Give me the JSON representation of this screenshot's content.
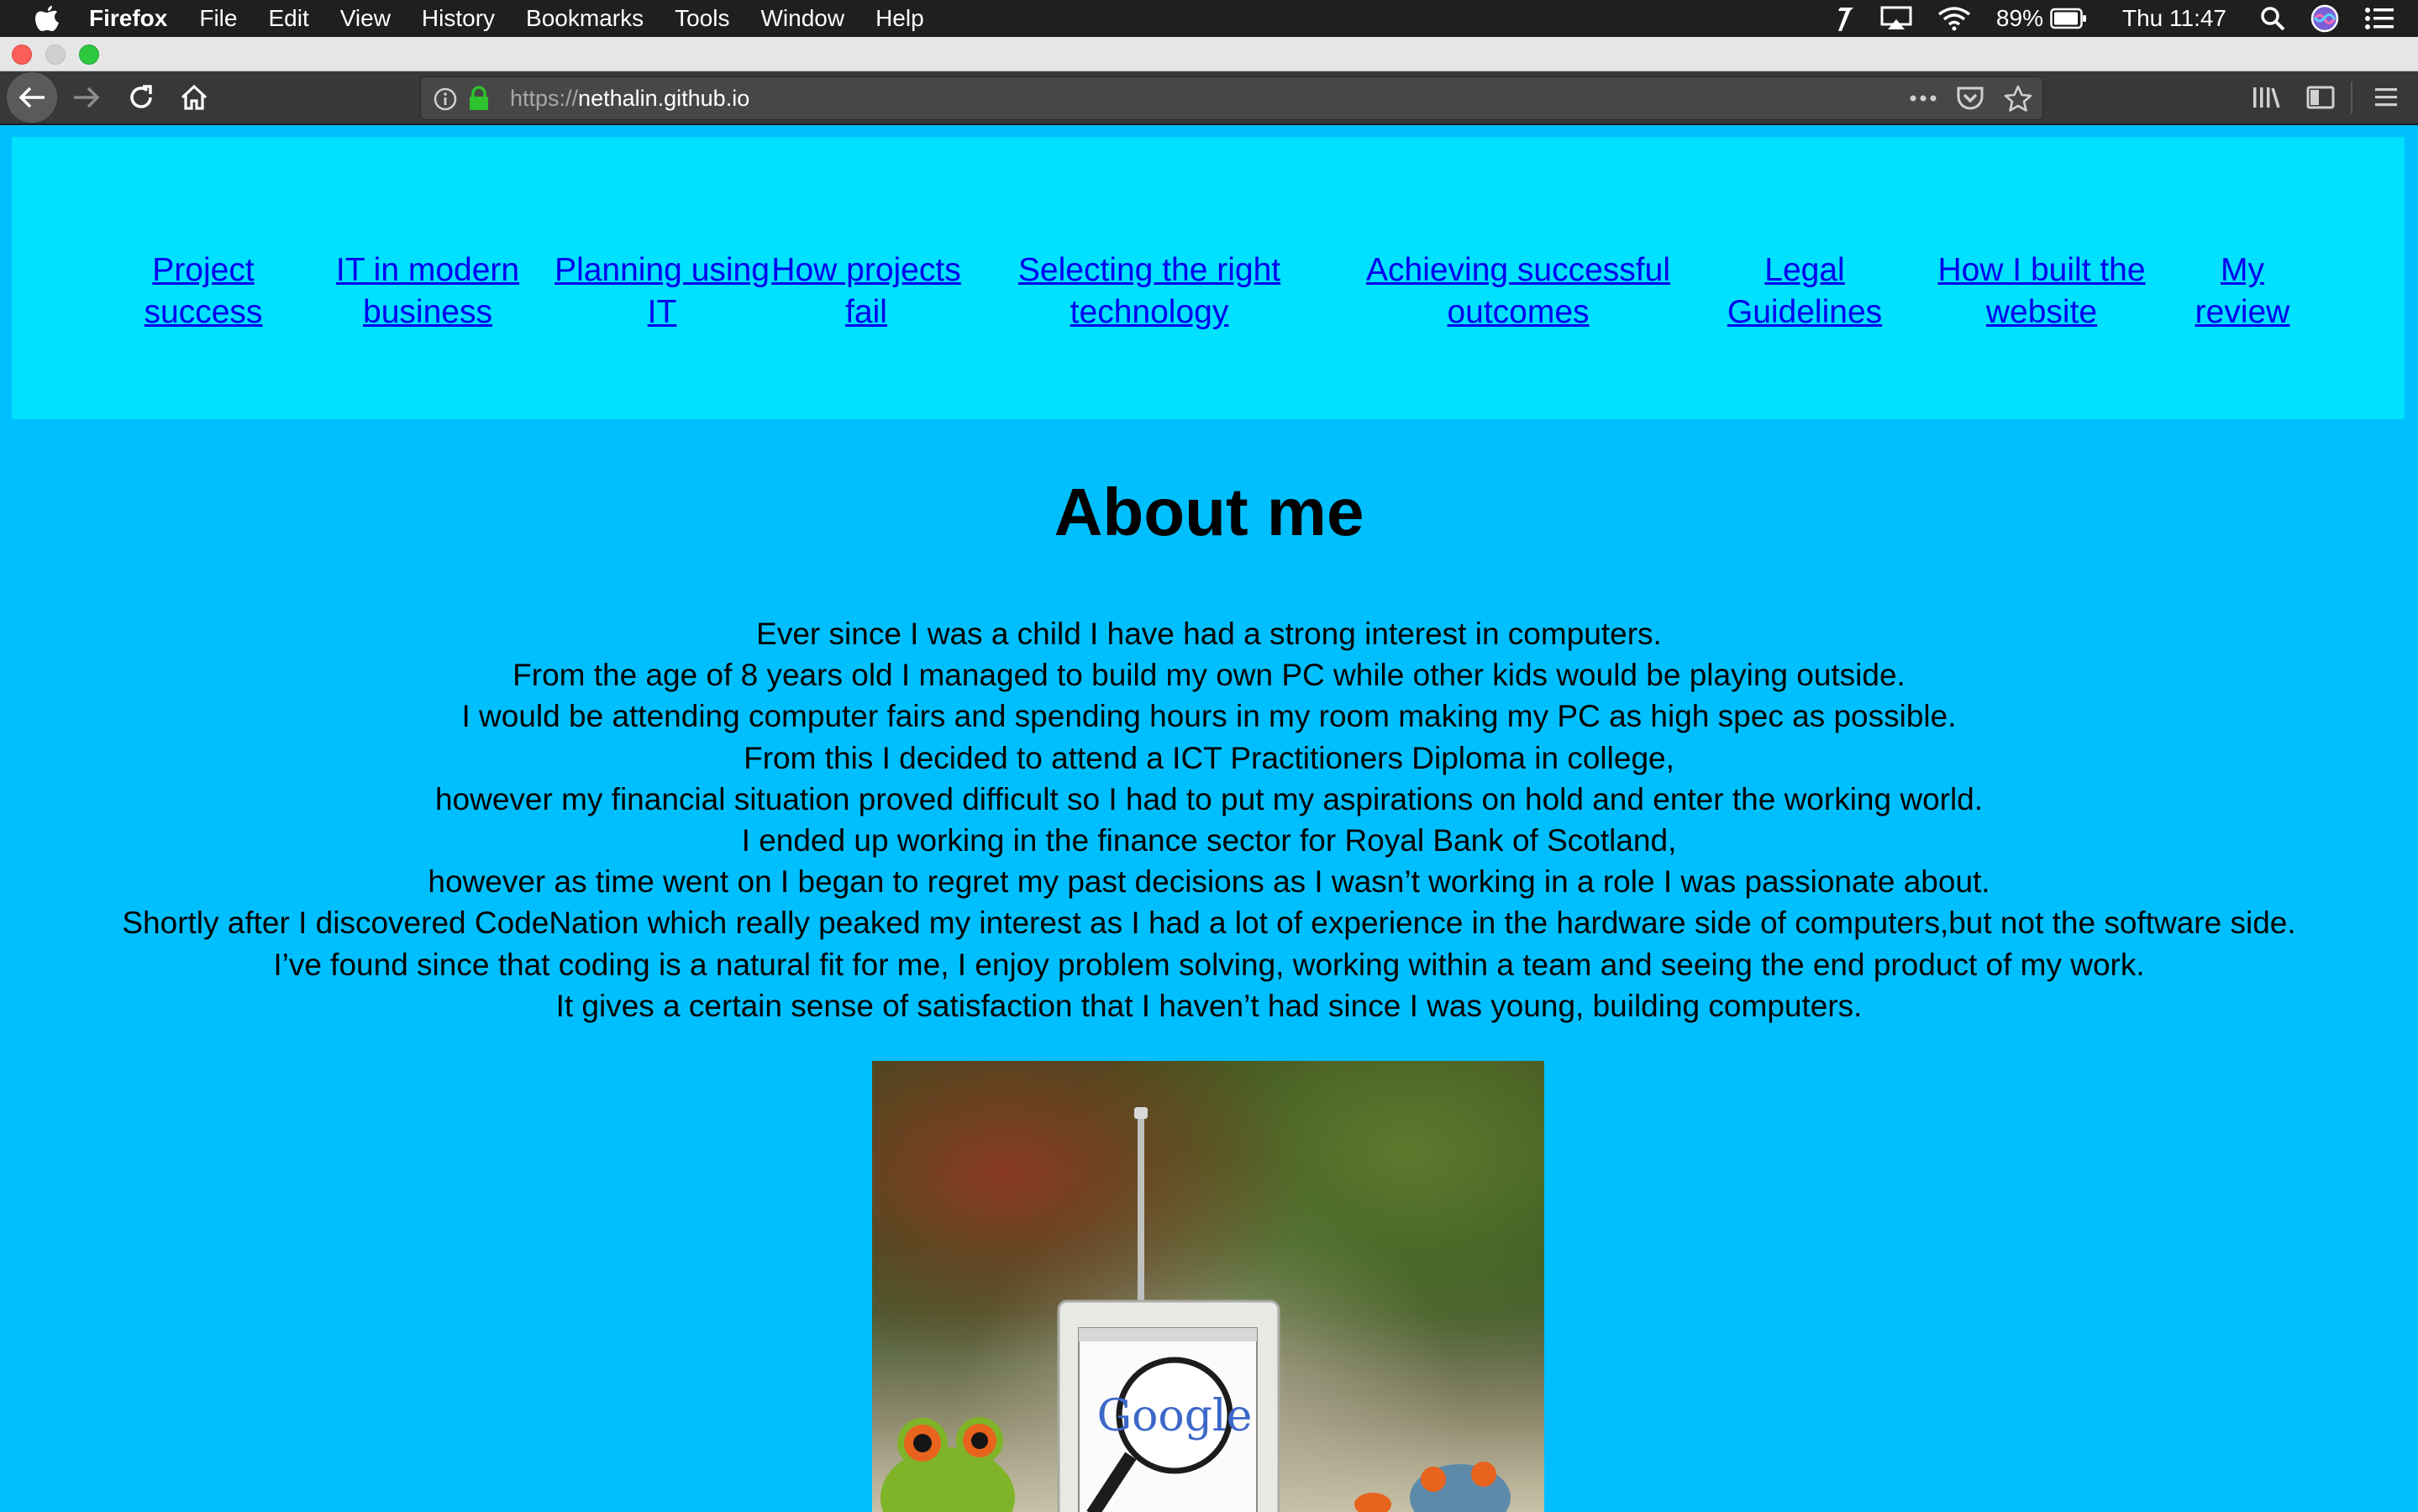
{
  "menubar": {
    "app_name": "Firefox",
    "menus": [
      "File",
      "Edit",
      "View",
      "History",
      "Bookmarks",
      "Tools",
      "Window",
      "Help"
    ],
    "battery": "89%",
    "clock": "Thu 11:47"
  },
  "browser": {
    "url_scheme": "https://",
    "url_host": "nethalin.github.io"
  },
  "nav": {
    "links": [
      "Project\nsuccess",
      "IT in modern\nbusiness",
      "Planning using\nIT",
      "How projects\nfail",
      "Selecting the right\ntechnology",
      "Achieving successful\noutcomes",
      "Legal\nGuidelines",
      "How I built the\nwebsite",
      "My\nreview"
    ]
  },
  "main": {
    "heading": "About me",
    "bio_lines": [
      "Ever since I was a child I have had a strong interest in computers.",
      "From the age of 8 years old I managed to build my own PC while other kids would be playing outside.",
      "I would be attending computer fairs and spending hours in my room making my PC as high spec as possible.",
      "From this I decided to attend a ICT Practitioners Diploma in college,",
      "however my financial situation proved difficult so I had to put my aspirations on hold and enter the working world.",
      "I ended up working in the finance sector for Royal Bank of Scotland,",
      "however as time went on I began to regret my past decisions as I wasn’t working in a role I was passionate about.",
      "Shortly after I discovered CodeNation which really peaked my interest as I had a lot of experience in the hardware side of computers,but not the software side.",
      "I’ve found since that coding is a natural fit for me, I enjoy problem solving, working within a team and seeing the end product of my work.",
      "It gives a certain sense of satisfaction that I haven’t had since I was young, building computers."
    ],
    "photo_screen_text": "Google"
  }
}
